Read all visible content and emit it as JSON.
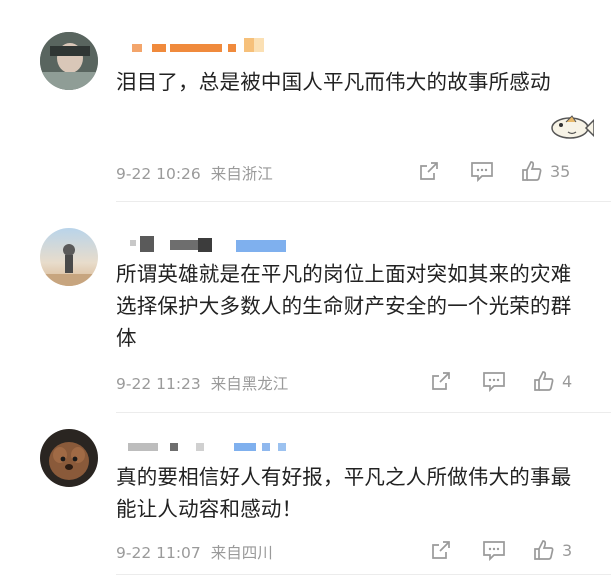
{
  "comments": [
    {
      "text": "泪目了，总是被中国人平凡而伟大的故事所感动",
      "time": "9-22 10:26",
      "location": "来自浙江",
      "likes": "35"
    },
    {
      "text": "所谓英雄就是在平凡的岗位上面对突如其来的灾难选择保护大多数人的生命财产安全的一个光荣的群体",
      "time": "9-22 11:23",
      "location": "来自黑龙江",
      "likes": "4"
    },
    {
      "text": "真的要相信好人有好报，平凡之人所做伟大的事最能让人动容和感动！",
      "time": "9-22 11:07",
      "location": "来自四川",
      "likes": "3"
    }
  ],
  "icons": {
    "share": "share-icon",
    "comment": "comment-icon",
    "like": "thumbs-up-icon",
    "sticker": "fish-sticker-icon"
  },
  "colors": {
    "meta_text": "#9a9a9a",
    "body_text": "#222222",
    "censor_orange": "#f08a3c",
    "censor_blue": "#7fb0ee",
    "censor_gray": "#6e6e6e"
  }
}
